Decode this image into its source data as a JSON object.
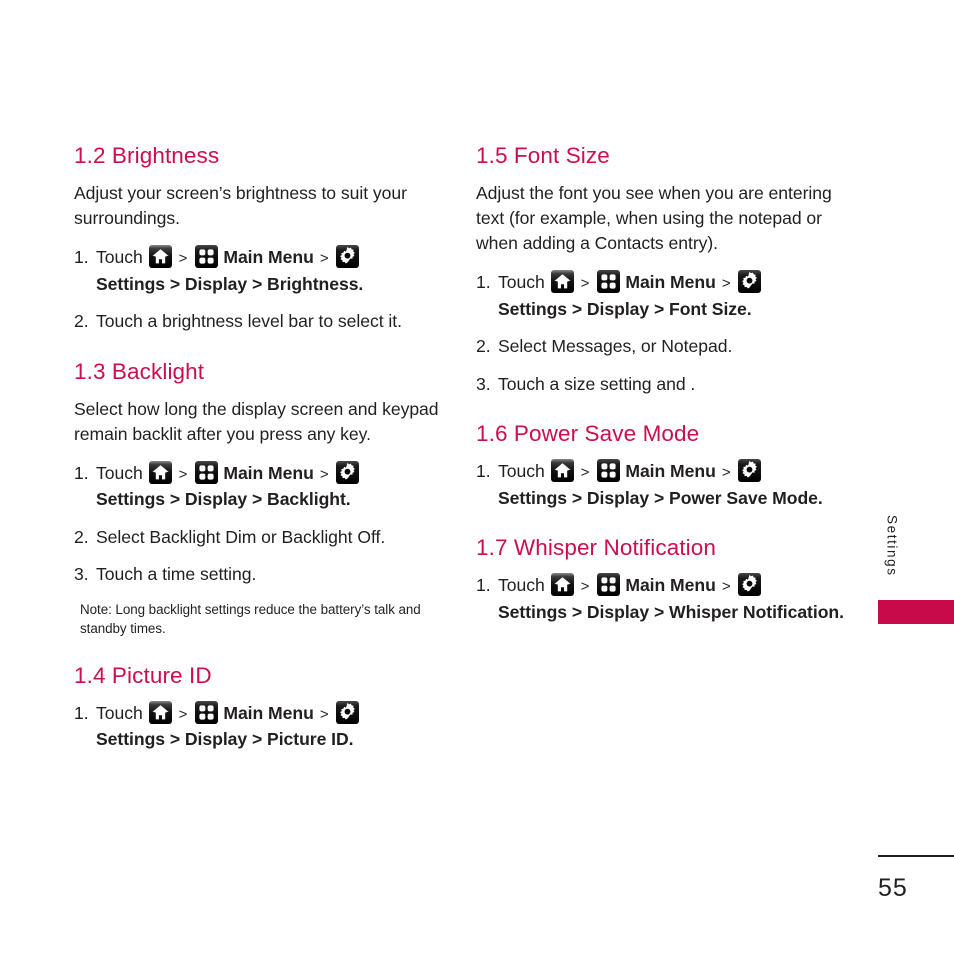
{
  "page": {
    "number": "55",
    "side_tab_label": "Settings",
    "accent_color": "#cd0e4d",
    "side_bar_color": "#c80a4b",
    "text_color": "#231f20",
    "background_color": "#ffffff"
  },
  "icons": {
    "home": "home-icon",
    "grid": "main-menu-grid-icon",
    "gear": "settings-gear-icon",
    "separator": ">"
  },
  "left_column": {
    "sections": [
      {
        "heading": "1.2 Brightness",
        "intro": "Adjust your screen’s brightness to suit your surroundings.",
        "steps": [
          {
            "num": "1.",
            "lead": "Touch",
            "icons": [
              "home",
              "grid",
              "gear"
            ],
            "menu_label": "Main Menu",
            "path": "Settings > Display > Brightness."
          },
          {
            "num": "2.",
            "text": "Touch a brightness level bar to select it."
          }
        ]
      },
      {
        "heading": "1.3 Backlight",
        "intro": "Select how long the display screen and keypad remain backlit after you press any key.",
        "steps": [
          {
            "num": "1.",
            "lead": "Touch",
            "icons": [
              "home",
              "grid",
              "gear"
            ],
            "menu_label": "Main Menu",
            "path": "Settings > Display > Backlight."
          },
          {
            "num": "2.",
            "text": "Select Backlight Dim or Backlight Off."
          },
          {
            "num": "3.",
            "text": "Touch a time setting."
          }
        ],
        "note": "Note: Long backlight settings reduce the battery’s talk and standby times."
      },
      {
        "heading": "1.4 Picture ID",
        "steps": [
          {
            "num": "1.",
            "lead": "Touch",
            "icons": [
              "home",
              "grid",
              "gear"
            ],
            "menu_label": "Main Menu",
            "path": "Settings > Display > Picture ID."
          }
        ]
      }
    ]
  },
  "right_column": {
    "sections": [
      {
        "heading": "1.5 Font Size",
        "intro": "Adjust the font you see when you are entering text (for example, when using the notepad or when adding a Contacts entry).",
        "steps": [
          {
            "num": "1.",
            "lead": "Touch",
            "icons": [
              "home",
              "grid",
              "gear"
            ],
            "menu_label": "Main Menu",
            "path": "Settings > Display > Font Size."
          },
          {
            "num": "2.",
            "text": "Select Messages, or Notepad."
          },
          {
            "num": "3.",
            "text": "Touch a size setting and ."
          }
        ]
      },
      {
        "heading": "1.6 Power Save Mode",
        "steps": [
          {
            "num": "1.",
            "lead": "Touch",
            "icons": [
              "home",
              "grid",
              "gear"
            ],
            "menu_label": "Main Menu",
            "path": "Settings > Display > Power Save Mode."
          }
        ]
      },
      {
        "heading": "1.7 Whisper Notification",
        "steps": [
          {
            "num": "1.",
            "lead": "Touch",
            "icons": [
              "home",
              "grid",
              "gear"
            ],
            "menu_label": "Main Menu",
            "path": "Settings > Display > Whisper Notification."
          }
        ]
      }
    ]
  }
}
